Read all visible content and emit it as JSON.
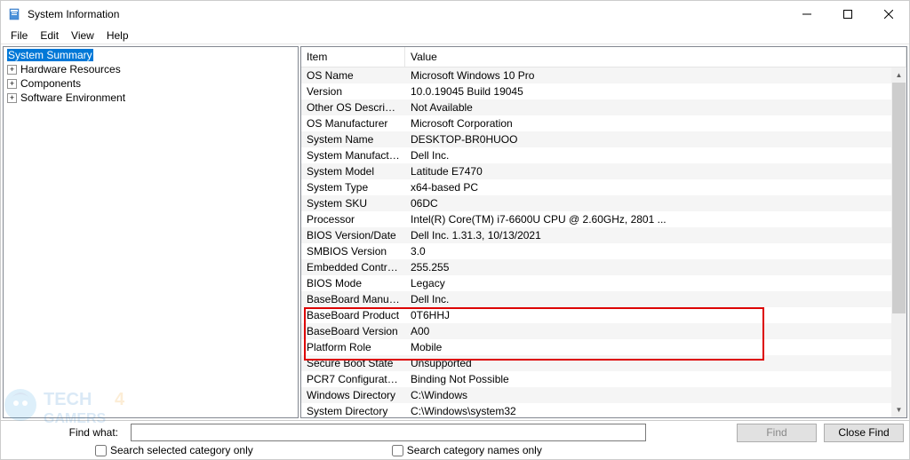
{
  "window": {
    "title": "System Information"
  },
  "menu": {
    "items": [
      "File",
      "Edit",
      "View",
      "Help"
    ]
  },
  "tree": {
    "items": [
      {
        "label": "System Summary",
        "selected": true,
        "expandable": false
      },
      {
        "label": "Hardware Resources",
        "selected": false,
        "expandable": true
      },
      {
        "label": "Components",
        "selected": false,
        "expandable": true
      },
      {
        "label": "Software Environment",
        "selected": false,
        "expandable": true
      }
    ]
  },
  "list": {
    "headers": {
      "item": "Item",
      "value": "Value"
    },
    "rows": [
      {
        "item": "OS Name",
        "value": "Microsoft Windows 10 Pro"
      },
      {
        "item": "Version",
        "value": "10.0.19045 Build 19045"
      },
      {
        "item": "Other OS Description",
        "value": "Not Available"
      },
      {
        "item": "OS Manufacturer",
        "value": "Microsoft Corporation"
      },
      {
        "item": "System Name",
        "value": "DESKTOP-BR0HUOO"
      },
      {
        "item": "System Manufacturer",
        "value": "Dell Inc."
      },
      {
        "item": "System Model",
        "value": "Latitude E7470"
      },
      {
        "item": "System Type",
        "value": "x64-based PC"
      },
      {
        "item": "System SKU",
        "value": "06DC"
      },
      {
        "item": "Processor",
        "value": "Intel(R) Core(TM) i7-6600U CPU @ 2.60GHz, 2801 ..."
      },
      {
        "item": "BIOS Version/Date",
        "value": "Dell Inc. 1.31.3, 10/13/2021"
      },
      {
        "item": "SMBIOS Version",
        "value": "3.0"
      },
      {
        "item": "Embedded Controll...",
        "value": "255.255"
      },
      {
        "item": "BIOS Mode",
        "value": "Legacy"
      },
      {
        "item": "BaseBoard Manufact...",
        "value": "Dell Inc."
      },
      {
        "item": "BaseBoard Product",
        "value": "0T6HHJ"
      },
      {
        "item": "BaseBoard Version",
        "value": "A00"
      },
      {
        "item": "Platform Role",
        "value": "Mobile"
      },
      {
        "item": "Secure Boot State",
        "value": "Unsupported"
      },
      {
        "item": "PCR7 Configuration",
        "value": "Binding Not Possible"
      },
      {
        "item": "Windows Directory",
        "value": "C:\\Windows"
      },
      {
        "item": "System Directory",
        "value": "C:\\Windows\\system32"
      }
    ]
  },
  "findbar": {
    "label": "Find what:",
    "value": "",
    "find_button": "Find",
    "close_button": "Close Find",
    "check1": "Search selected category only",
    "check2": "Search category names only"
  }
}
